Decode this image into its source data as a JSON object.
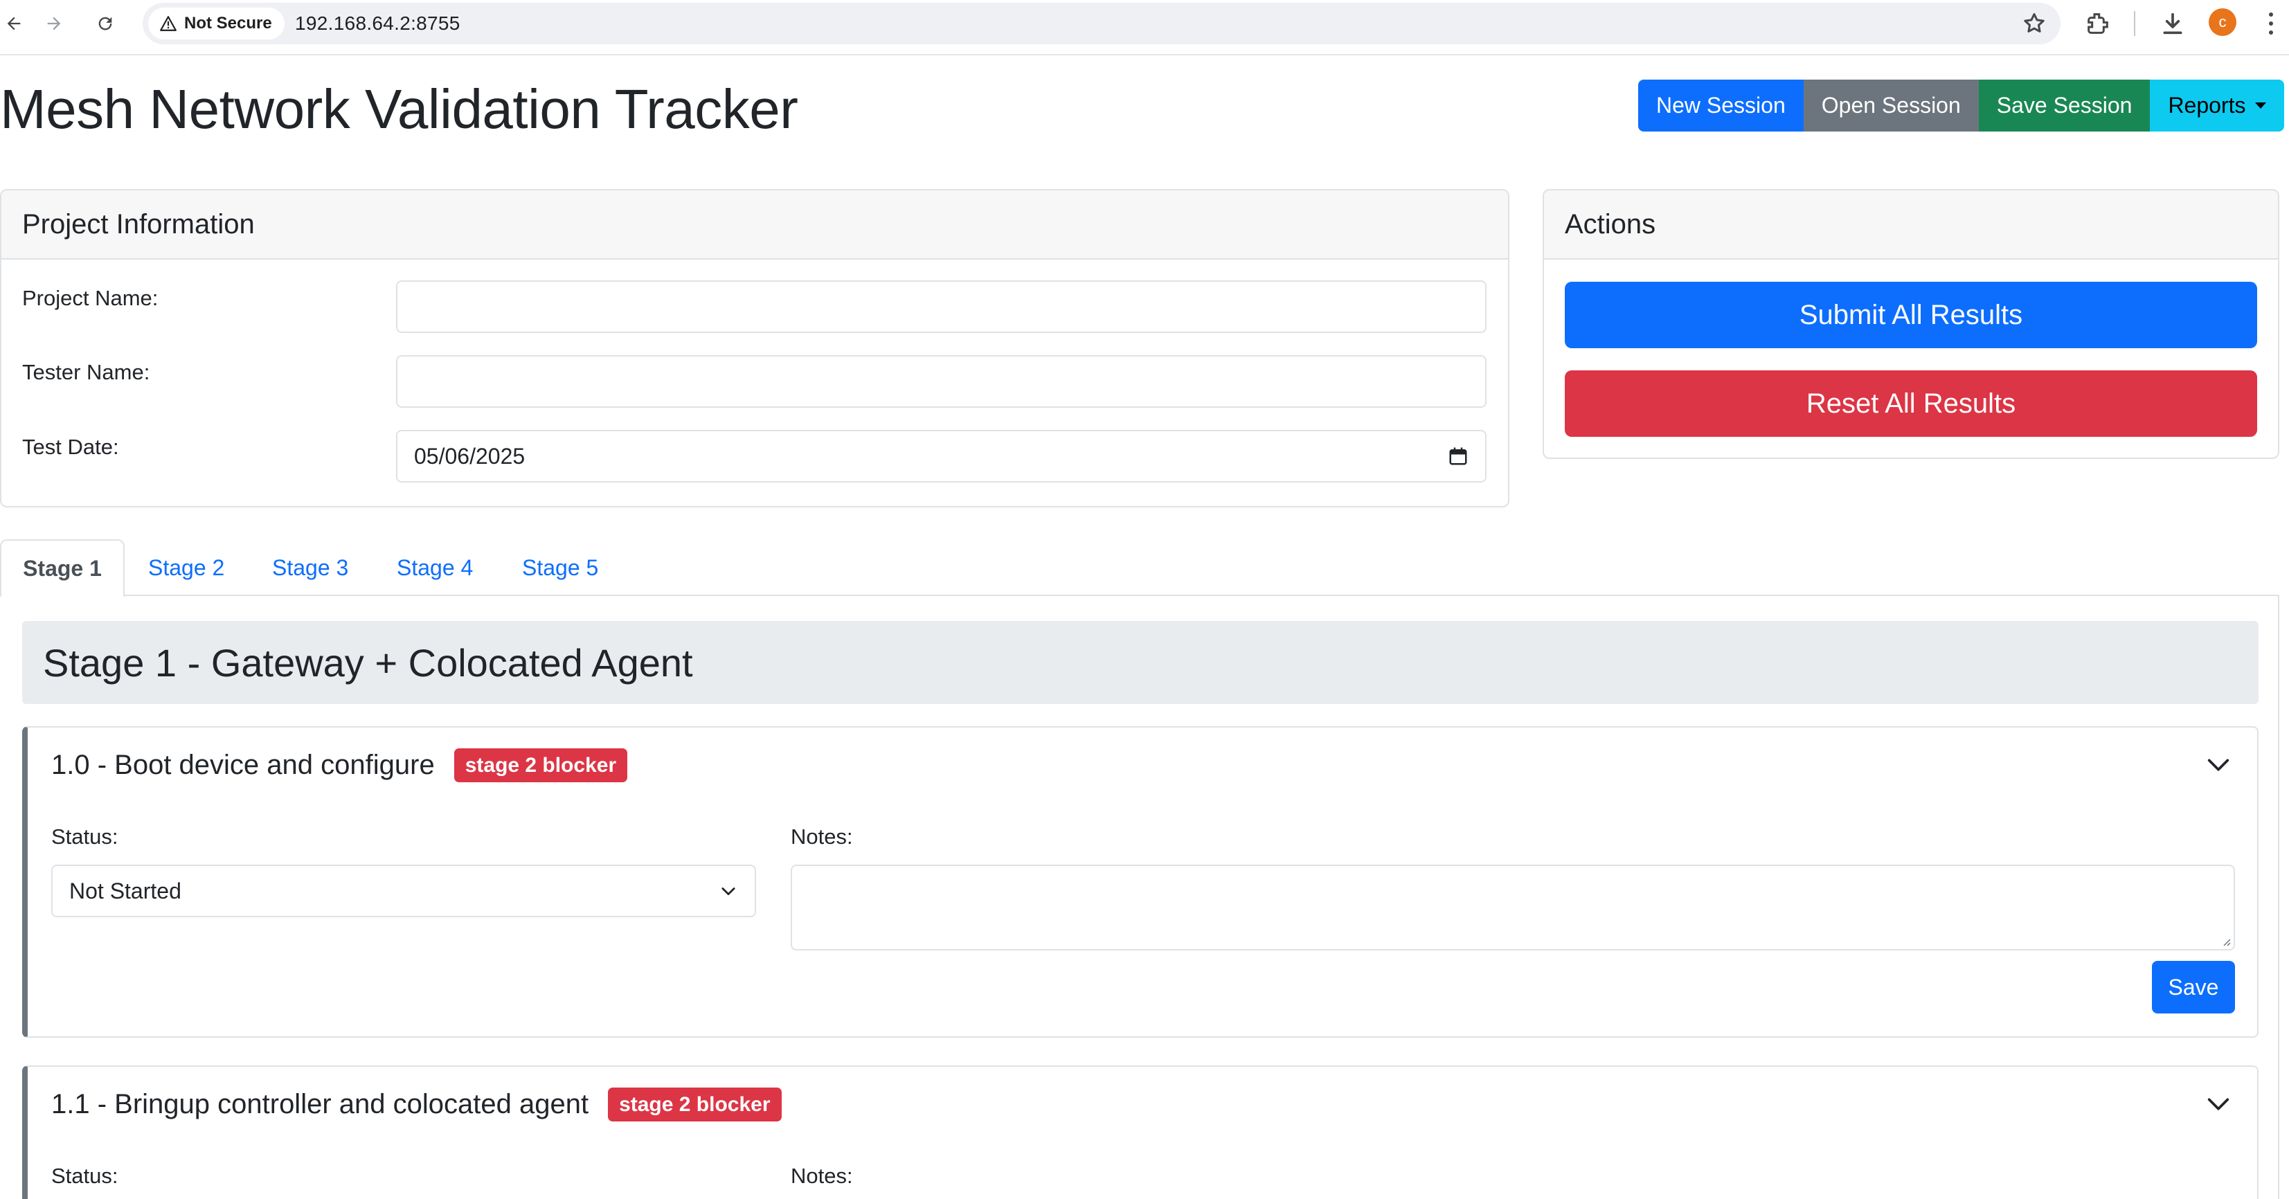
{
  "browser": {
    "security_label": "Not Secure",
    "url": "192.168.64.2:8755",
    "profile_initial": "c"
  },
  "header": {
    "title": "Mesh Network Validation Tracker",
    "buttons": {
      "new_session": "New Session",
      "open_session": "Open Session",
      "save_session": "Save Session",
      "reports": "Reports"
    }
  },
  "project_info": {
    "heading": "Project Information",
    "project_name_label": "Project Name:",
    "project_name_value": "",
    "tester_name_label": "Tester Name:",
    "tester_name_value": "",
    "test_date_label": "Test Date:",
    "test_date_value": "05/06/2025"
  },
  "actions": {
    "heading": "Actions",
    "submit_label": "Submit All Results",
    "reset_label": "Reset All Results"
  },
  "tabs": [
    {
      "label": "Stage 1",
      "active": true
    },
    {
      "label": "Stage 2",
      "active": false
    },
    {
      "label": "Stage 3",
      "active": false
    },
    {
      "label": "Stage 4",
      "active": false
    },
    {
      "label": "Stage 5",
      "active": false
    }
  ],
  "stage": {
    "title": "Stage 1 - Gateway + Colocated Agent",
    "tests": [
      {
        "title": "1.0 - Boot device and configure",
        "badge": "stage 2 blocker",
        "status_label": "Status:",
        "status_value": "Not Started",
        "notes_label": "Notes:",
        "notes_value": "",
        "save_label": "Save"
      },
      {
        "title": "1.1 - Bringup controller and colocated agent",
        "badge": "stage 2 blocker",
        "status_label": "Status:",
        "notes_label": "Notes:"
      }
    ]
  },
  "colors": {
    "primary": "#0d6efd",
    "secondary": "#6c757d",
    "success": "#198754",
    "info": "#0dcaf0",
    "danger": "#dc3545"
  },
  "icons": [
    "back-arrow-icon",
    "forward-arrow-icon",
    "reload-icon",
    "warning-icon",
    "star-icon",
    "extensions-icon",
    "download-icon",
    "menu-kebab-icon",
    "calendar-icon",
    "chevron-down-icon",
    "dropdown-caret-icon"
  ]
}
